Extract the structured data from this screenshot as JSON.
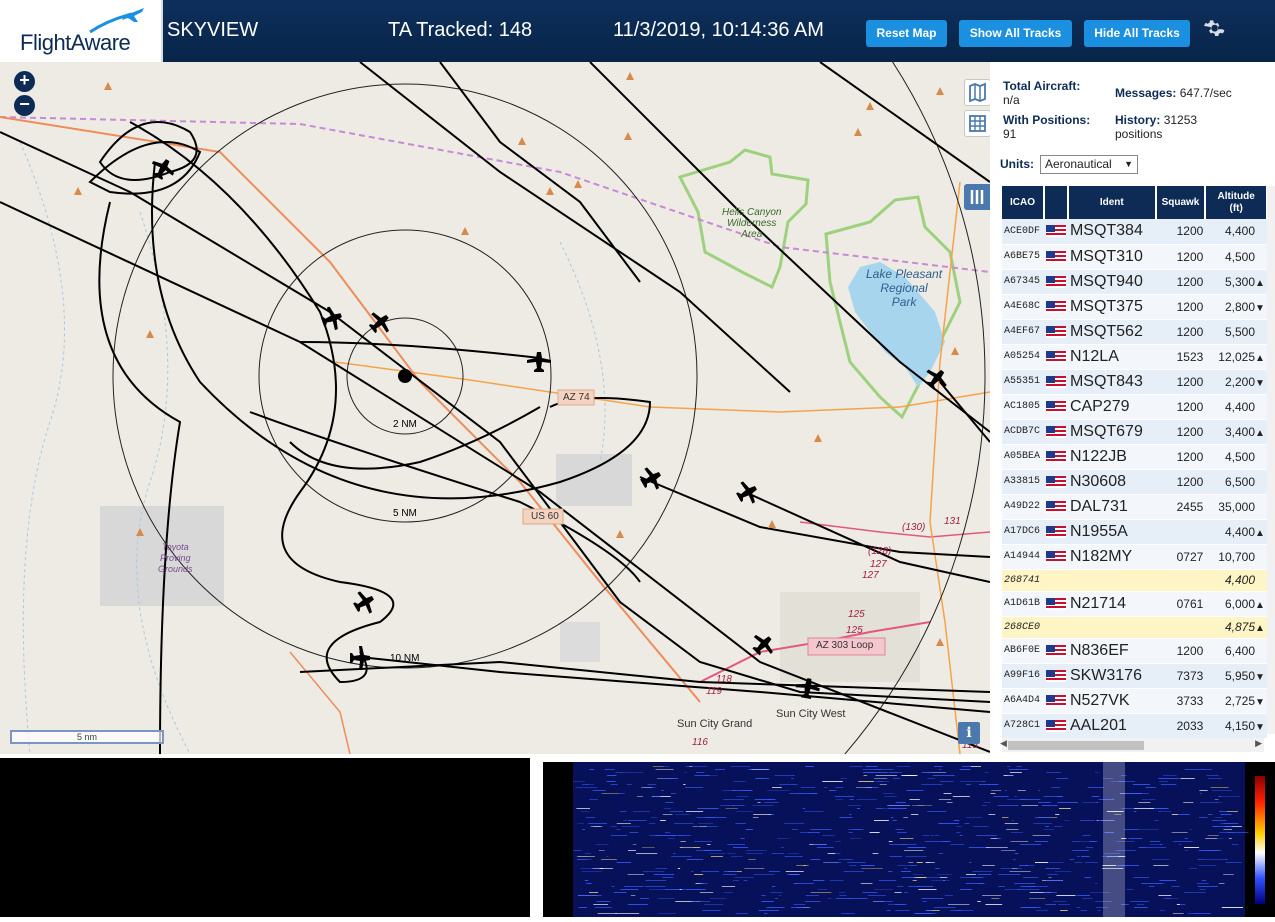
{
  "header": {
    "logo_text": "FlightAware",
    "site_name": "SKYVIEW",
    "ta_tracked": "TA Tracked: 148",
    "datetime": "11/3/2019, 10:14:36 AM",
    "buttons": {
      "reset": "Reset Map",
      "show_all": "Show All Tracks",
      "hide_all": "Hide All Tracks"
    }
  },
  "map": {
    "zoom_in": "+",
    "zoom_out": "−",
    "scale_label": "5 nm",
    "info": "i",
    "ring_labels": [
      "2 NM",
      "5 NM",
      "10 NM"
    ],
    "places": {
      "hells_canyon": [
        "Hells Canyon",
        "Wilderness",
        "Area"
      ],
      "lake_pleasant": [
        "Lake Pleasant",
        "Regional",
        "Park"
      ],
      "toyota": [
        "Toyota",
        "Proving",
        "Grounds"
      ],
      "sun_city_grand": "Sun City Grand",
      "sun_city_west": "Sun City West"
    },
    "roads": {
      "az74": "AZ 74",
      "us60": "US 60",
      "az303": "AZ 303 Loop"
    },
    "road_nums": [
      "(130)",
      "131",
      "(128)",
      "127",
      "127",
      "125",
      "125",
      "119",
      "118",
      "116",
      "115"
    ]
  },
  "stats": {
    "total_label": "Total Aircraft:",
    "total_value": "n/a",
    "messages_label": "Messages:",
    "messages_value": "647.7/sec",
    "positions_label": "With Positions:",
    "positions_value": "91",
    "history_label": "History:",
    "history_value": "31253",
    "history_unit": "positions"
  },
  "units": {
    "label": "Units:",
    "value": "Aeronautical"
  },
  "table": {
    "headers": {
      "icao": "ICAO",
      "ident": "Ident",
      "squawk": "Squawk",
      "altitude": "Altitude",
      "altitude_unit": "(ft)"
    },
    "rows": [
      {
        "icao": "ACE0DF",
        "ident": "MSQT384",
        "squawk": "1200",
        "altitude": "4,400",
        "trend": ""
      },
      {
        "icao": "A6BE75",
        "ident": "MSQT310",
        "squawk": "1200",
        "altitude": "4,500",
        "trend": ""
      },
      {
        "icao": "A67345",
        "ident": "MSQT940",
        "squawk": "1200",
        "altitude": "5,300",
        "trend": "▲"
      },
      {
        "icao": "A4E68C",
        "ident": "MSQT375",
        "squawk": "1200",
        "altitude": "2,800",
        "trend": "▼"
      },
      {
        "icao": "A4EF67",
        "ident": "MSQT562",
        "squawk": "1200",
        "altitude": "5,500",
        "trend": ""
      },
      {
        "icao": "A05254",
        "ident": "N12LA",
        "squawk": "1523",
        "altitude": "12,025",
        "trend": "▲"
      },
      {
        "icao": "A55351",
        "ident": "MSQT843",
        "squawk": "1200",
        "altitude": "2,200",
        "trend": "▼"
      },
      {
        "icao": "AC1805",
        "ident": "CAP279",
        "squawk": "1200",
        "altitude": "4,400",
        "trend": ""
      },
      {
        "icao": "ACDB7C",
        "ident": "MSQT679",
        "squawk": "1200",
        "altitude": "3,400",
        "trend": "▲"
      },
      {
        "icao": "A05BEA",
        "ident": "N122JB",
        "squawk": "1200",
        "altitude": "4,500",
        "trend": ""
      },
      {
        "icao": "A33815",
        "ident": "N30608",
        "squawk": "1200",
        "altitude": "6,500",
        "trend": ""
      },
      {
        "icao": "A49D22",
        "ident": "DAL731",
        "squawk": "2455",
        "altitude": "35,000",
        "trend": ""
      },
      {
        "icao": "A17DC6",
        "ident": "N1955A",
        "squawk": "",
        "altitude": "4,400",
        "trend": "▲"
      },
      {
        "icao": "A14944",
        "ident": "N182MY",
        "squawk": "0727",
        "altitude": "10,700",
        "trend": ""
      },
      {
        "icao": "268741",
        "ident": "",
        "squawk": "",
        "altitude": "4,400",
        "trend": "",
        "highlight": true
      },
      {
        "icao": "A1D61B",
        "ident": "N21714",
        "squawk": "0761",
        "altitude": "6,000",
        "trend": "▲"
      },
      {
        "icao": "268CE0",
        "ident": "",
        "squawk": "",
        "altitude": "4,875",
        "trend": "▲",
        "highlight": true
      },
      {
        "icao": "AB6F0E",
        "ident": "N836EF",
        "squawk": "1200",
        "altitude": "6,400",
        "trend": ""
      },
      {
        "icao": "A99F16",
        "ident": "SKW3176",
        "squawk": "7373",
        "altitude": "5,950",
        "trend": "▼"
      },
      {
        "icao": "A6A4D4",
        "ident": "N527VK",
        "squawk": "3733",
        "altitude": "2,725",
        "trend": "▼"
      },
      {
        "icao": "A728C1",
        "ident": "AAL201",
        "squawk": "2033",
        "altitude": "4,150",
        "trend": "▼"
      }
    ]
  },
  "colors": {
    "header_bg": "#0d2f5c",
    "button": "#1b8fe0",
    "table_header": "#0d2b55",
    "highlight_row": "#fdf5c6"
  },
  "icons": [
    "plane-logo-icon",
    "gear-icon",
    "map-layers-icon",
    "grid-icon",
    "columns-icon",
    "info-icon",
    "aircraft-icon",
    "receiver-icon"
  ]
}
